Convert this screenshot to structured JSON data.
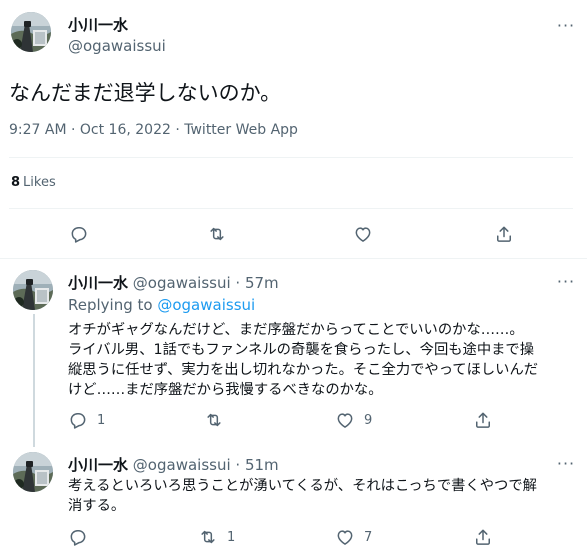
{
  "main_tweet": {
    "display_name": "小川一水",
    "handle": "@ogawaissui",
    "text": "なんだまだ退学しないのか。",
    "timestamp": "9:27 AM · Oct 16, 2022 · Twitter Web App",
    "likes": {
      "count": "8",
      "label": "Likes"
    },
    "actions": [
      "reply-icon",
      "retweet-icon",
      "like-icon",
      "share-icon"
    ]
  },
  "replies": [
    {
      "display_name": "小川一水",
      "handle": "@ogawaissui",
      "time": "· 57m",
      "replying_label": "Replying to",
      "replying_to": "@ogawaissui",
      "lines": [
        "オチがギャグなんだけど、まだ序盤だからってことでいいのかな……。",
        "ライバル男、1話でもファンネルの奇襲を食らったし、今回も途中まで操",
        "縦思うに任せず、実力を出し切れなかった。そこ全力でやってほしいんだ",
        "けど……まだ序盤だから我慢するべきなのかな。"
      ],
      "reply_count": "1",
      "retweet_count": "",
      "like_count": "9"
    },
    {
      "display_name": "小川一水",
      "handle": "@ogawaissui",
      "time": "· 51m",
      "lines": [
        "考えるといろいろ思うことが湧いてくるが、それはこっちで書くやつで解",
        "消する。"
      ],
      "reply_count": "",
      "retweet_count": "1",
      "like_count": "7"
    }
  ],
  "colors": {
    "text_primary": "#0f1419",
    "text_secondary": "#536471",
    "link": "#1d9bf0",
    "divider": "#eff3f4",
    "thread_line": "#cfd9de"
  }
}
